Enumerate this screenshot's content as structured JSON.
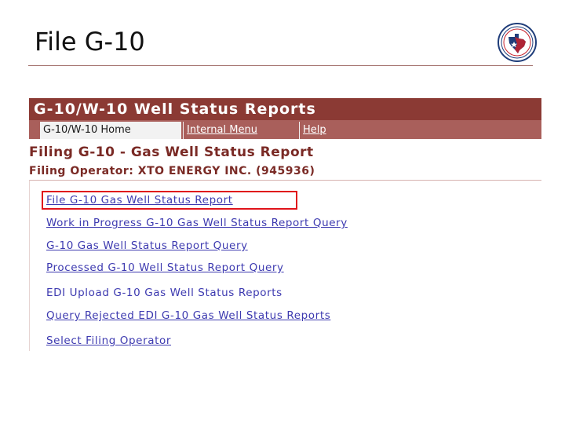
{
  "slide": {
    "title": "File G-10"
  },
  "app": {
    "header_title": "G-10/W-10 Well Status Reports",
    "nav": {
      "home_tab": "G-10/W-10 Home",
      "internal_menu": "Internal Menu",
      "help": "Help"
    },
    "page_heading": "Filing G-10 - Gas Well Status Report",
    "filing_operator": "Filing Operator: XTO ENERGY INC. (945936)",
    "links": [
      {
        "label": "File G-10 Gas Well Status Report",
        "highlighted": true
      },
      {
        "label": "Work in Progress G-10 Gas Well Status Report Query"
      },
      {
        "label": "G-10 Gas Well Status Report Query"
      },
      {
        "label": "Processed G-10 Well Status Report Query"
      },
      {
        "label": "EDI Upload G-10 Gas Well Status Reports"
      },
      {
        "label": "Query Rejected EDI G-10 Gas Well Status Reports"
      },
      {
        "label": "Select Filing Operator"
      }
    ]
  },
  "colors": {
    "header_bg": "#8b3a34",
    "nav_bg": "#a95f5b",
    "heading_text": "#7a2a25",
    "link_text": "#3d3ab0",
    "highlight": "#e0141b"
  },
  "icons": {
    "logo": "texas-state-seal-icon"
  }
}
